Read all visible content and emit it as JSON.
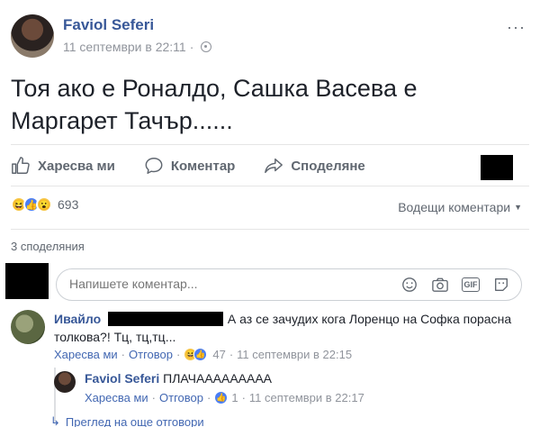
{
  "post": {
    "author": "Faviol Seferi",
    "timestamp": "11 септември в 22:11",
    "text": "Тоя ако е Роналдо, Сашка Васева е Маргарет Тачър......",
    "more_icon": "···"
  },
  "actions": {
    "like": "Харесва ми",
    "comment": "Коментар",
    "share": "Споделяне"
  },
  "reactions": {
    "types": [
      "haha",
      "like",
      "wow"
    ],
    "count": "693"
  },
  "sort_label": "Водещи коментари",
  "shares_label": "3 споделяния",
  "composer": {
    "placeholder": "Напишете коментар...",
    "icons": [
      "emoji-icon",
      "camera-icon",
      "gif-icon",
      "sticker-icon"
    ],
    "gif_label": "GIF"
  },
  "comments": [
    {
      "author": "Ивайло",
      "text": "А аз се зачудих кога Лоренцо на Софка порасна толкова?! Тц, тц,тц...",
      "like": "Харесва ми",
      "reply": "Отговор",
      "reaction_count": "47",
      "timestamp": "11 септември в 22:15",
      "replies": [
        {
          "author": "Faviol Seferi",
          "text": "ПЛАЧААААААААА",
          "like": "Харесва ми",
          "reply": "Отговор",
          "reaction_count": "1",
          "timestamp": "11 септември в 22:17"
        }
      ]
    }
  ],
  "more_replies": "Преглед на още отговори",
  "colors": {
    "link": "#385898",
    "meta": "#90949c",
    "action": "#606770",
    "like_blue": "#4a7ef6"
  }
}
